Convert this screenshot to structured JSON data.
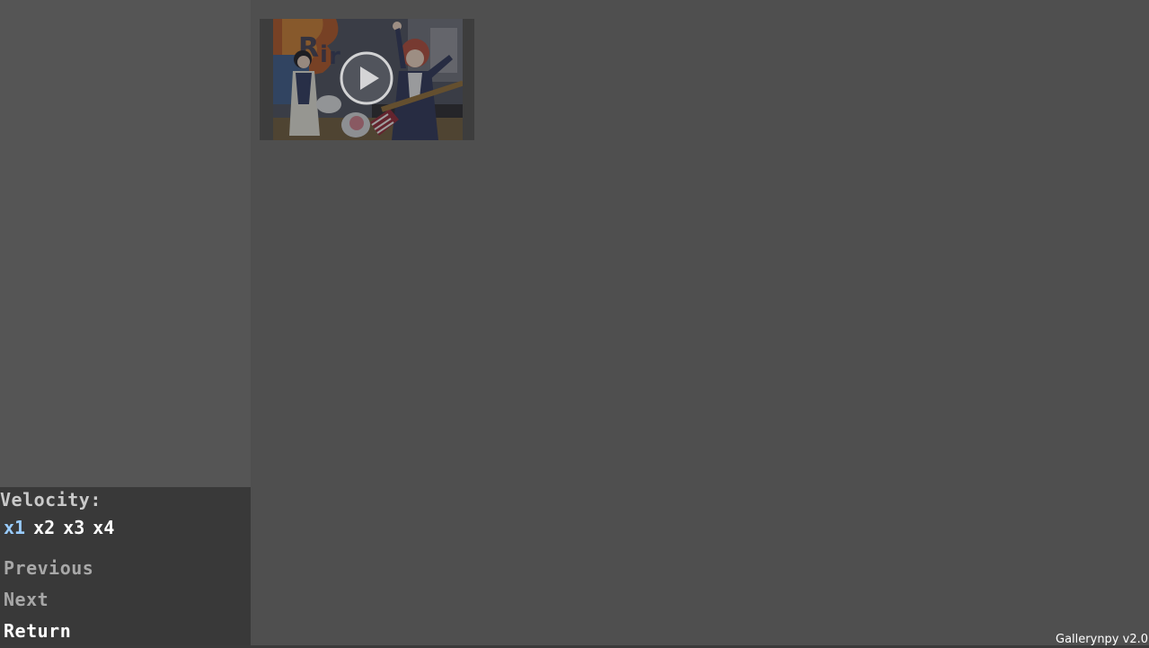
{
  "app": {
    "version_label": "Gallerynpy v2.0"
  },
  "controls": {
    "velocity_label": "Velocity:",
    "speeds": [
      "x1",
      "x2",
      "x3",
      "x4"
    ],
    "active_speed": "x1",
    "previous_label": "Previous",
    "next_label": "Next",
    "return_label": "Return"
  },
  "gallery": {
    "items": [
      {
        "type": "video",
        "icon": "play-icon"
      }
    ]
  },
  "colors": {
    "background": "#4f4f4f",
    "sidebar": "#555555",
    "panel": "#393939",
    "active_speed": "#99ccff",
    "dim_text": "#a8a8a8",
    "text": "#ffffff"
  }
}
